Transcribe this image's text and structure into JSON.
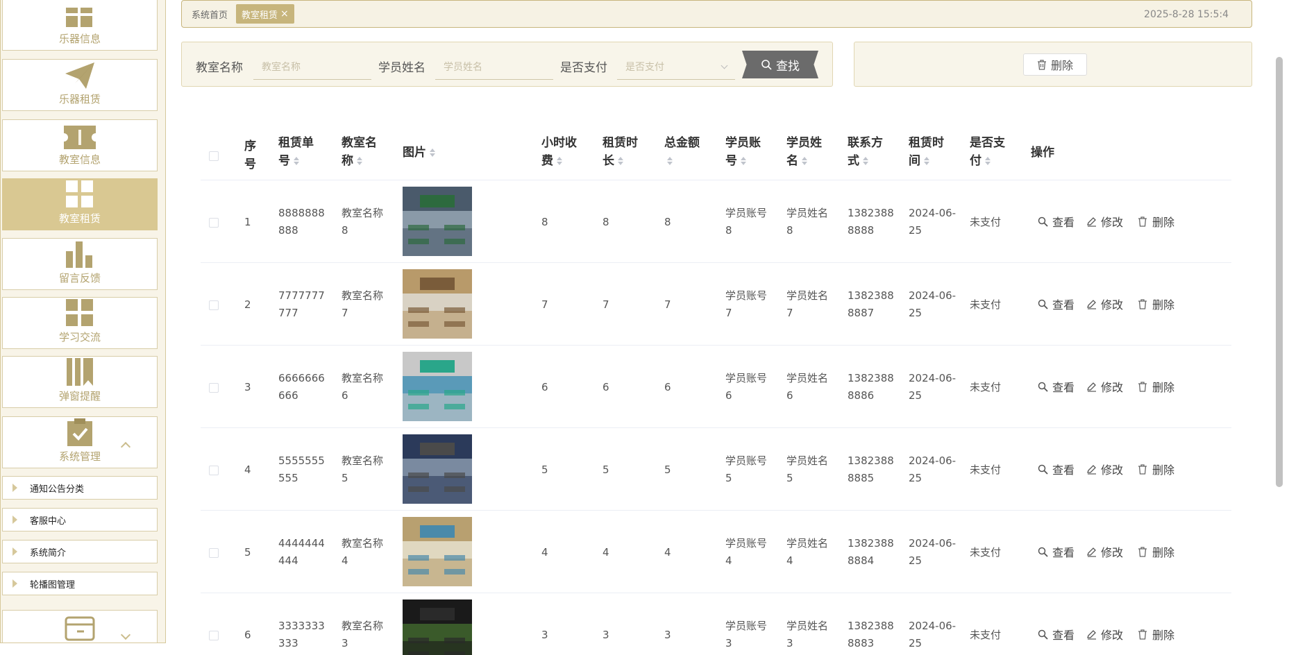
{
  "sidebar": {
    "items": [
      {
        "label": "乐器信息",
        "icon": "grid-icon"
      },
      {
        "label": "乐器租赁",
        "icon": "paper-plane-icon"
      },
      {
        "label": "教室信息",
        "icon": "ticket-icon"
      },
      {
        "label": "教室租赁",
        "icon": "grid-icon",
        "active": true
      },
      {
        "label": "留言反馈",
        "icon": "bar-chart-icon"
      },
      {
        "label": "学习交流",
        "icon": "grid-icon"
      },
      {
        "label": "弹窗提醒",
        "icon": "bookmark-icon"
      },
      {
        "label": "系统管理",
        "icon": "clipboard-check-icon"
      }
    ],
    "sub_items": [
      "通知公告分类",
      "客服中心",
      "系统简介",
      "轮播图管理"
    ]
  },
  "breadcrumb": {
    "home": "系统首页",
    "current": "教室租赁",
    "close": "×"
  },
  "clock": "2025-8-28 15:5:4",
  "search": {
    "room_label": "教室名称",
    "room_placeholder": "教室名称",
    "student_label": "学员姓名",
    "student_placeholder": "学员姓名",
    "paid_label": "是否支付",
    "paid_placeholder": "是否支付",
    "button": "查找"
  },
  "actions": {
    "delete": "删除"
  },
  "table": {
    "headers": {
      "index": [
        "序",
        "号"
      ],
      "order_no": [
        "租赁单",
        "号"
      ],
      "room": [
        "教室名",
        "称"
      ],
      "image": "图片",
      "hourly": [
        "小时收",
        "费"
      ],
      "duration": [
        "租赁时",
        "长"
      ],
      "total": [
        "总金额",
        ""
      ],
      "account": [
        "学员账",
        "号"
      ],
      "student": [
        "学员姓",
        "名"
      ],
      "phone": [
        "联系方",
        "式"
      ],
      "time": [
        "租赁时",
        "间"
      ],
      "paid": [
        "是否支",
        "付"
      ],
      "ops": "操作"
    },
    "op_labels": {
      "view": "查看",
      "edit": "修改",
      "delete": "删除"
    },
    "rows": [
      {
        "index": "1",
        "order": [
          "8888888",
          "888"
        ],
        "room": [
          "教室名称",
          "8"
        ],
        "hourly": "8",
        "duration": "8",
        "total": "8",
        "account": [
          "学员账号",
          "8"
        ],
        "student": [
          "学员姓名",
          "8"
        ],
        "phone": [
          "1382388",
          "8888"
        ],
        "time": [
          "2024-06-",
          "25"
        ],
        "paid": "未支付"
      },
      {
        "index": "2",
        "order": [
          "7777777",
          "777"
        ],
        "room": [
          "教室名称",
          "7"
        ],
        "hourly": "7",
        "duration": "7",
        "total": "7",
        "account": [
          "学员账号",
          "7"
        ],
        "student": [
          "学员姓名",
          "7"
        ],
        "phone": [
          "1382388",
          "8887"
        ],
        "time": [
          "2024-06-",
          "25"
        ],
        "paid": "未支付"
      },
      {
        "index": "3",
        "order": [
          "6666666",
          "666"
        ],
        "room": [
          "教室名称",
          "6"
        ],
        "hourly": "6",
        "duration": "6",
        "total": "6",
        "account": [
          "学员账号",
          "6"
        ],
        "student": [
          "学员姓名",
          "6"
        ],
        "phone": [
          "1382388",
          "8886"
        ],
        "time": [
          "2024-06-",
          "25"
        ],
        "paid": "未支付"
      },
      {
        "index": "4",
        "order": [
          "5555555",
          "555"
        ],
        "room": [
          "教室名称",
          "5"
        ],
        "hourly": "5",
        "duration": "5",
        "total": "5",
        "account": [
          "学员账号",
          "5"
        ],
        "student": [
          "学员姓名",
          "5"
        ],
        "phone": [
          "1382388",
          "8885"
        ],
        "time": [
          "2024-06-",
          "25"
        ],
        "paid": "未支付"
      },
      {
        "index": "5",
        "order": [
          "4444444",
          "444"
        ],
        "room": [
          "教室名称",
          "4"
        ],
        "hourly": "4",
        "duration": "4",
        "total": "4",
        "account": [
          "学员账号",
          "4"
        ],
        "student": [
          "学员姓名",
          "4"
        ],
        "phone": [
          "1382388",
          "8884"
        ],
        "time": [
          "2024-06-",
          "25"
        ],
        "paid": "未支付"
      },
      {
        "index": "6",
        "order": [
          "3333333",
          "333"
        ],
        "room": [
          "教室名称",
          "3"
        ],
        "hourly": "3",
        "duration": "3",
        "total": "3",
        "account": [
          "学员账号",
          "3"
        ],
        "student": [
          "学员姓名",
          "3"
        ],
        "phone": [
          "1382388",
          "8883"
        ],
        "time": [
          "2024-06-",
          "25"
        ],
        "paid": "未支付"
      }
    ]
  },
  "colors": {
    "accent": "#c7b57c",
    "active_menu": "#d9c892",
    "icon": "#b3a36f",
    "panel": "#f8f5ea"
  }
}
